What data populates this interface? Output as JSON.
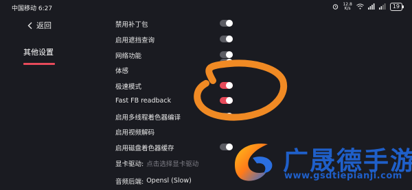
{
  "status_bar": {
    "carrier_time": "中国移动 6:27",
    "net_speed_value": "12.8",
    "net_speed_unit": "K/s",
    "battery": "19"
  },
  "sidebar": {
    "back_label": "返回",
    "section_label": "其他设置"
  },
  "settings": [
    {
      "label": "禁用补丁包",
      "toggle": "off"
    },
    {
      "label": "启用遮挡查询",
      "toggle": "off"
    },
    {
      "label": "网络功能",
      "toggle": "off"
    },
    {
      "label": "体感",
      "toggle": "off"
    },
    {
      "label": "极速模式",
      "toggle": "on"
    },
    {
      "label": "Fast FB readback",
      "toggle": "on"
    },
    {
      "label": "启用多线程着色器编译",
      "toggle": "off"
    },
    {
      "label": "启用视频解码",
      "toggle": "off"
    },
    {
      "label": "启用磁盘着色器缓存",
      "toggle": "off"
    },
    {
      "label": "显卡驱动:",
      "placeholder": "点击选择显卡驱动"
    },
    {
      "label": "音频后端:",
      "value": "Opensl (Slow)"
    }
  ],
  "watermark": {
    "brand": "广晟德手游",
    "url": "www.gsdtiepianji.com",
    "color": "#1f5fc9"
  },
  "colors": {
    "background": "#1a1b21",
    "accent": "#e74a5a",
    "toggle_off": "#5b5c63",
    "annotation": "#f08a24"
  }
}
